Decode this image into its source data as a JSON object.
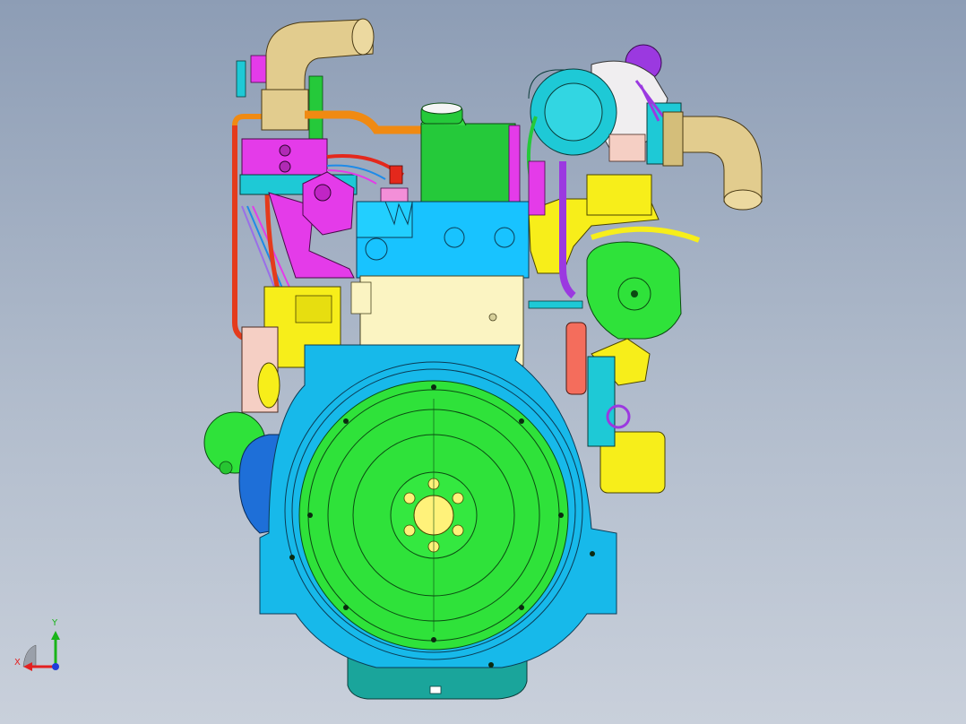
{
  "viewport": {
    "background_top": "#8d9db5",
    "background_bottom": "#c9d0db"
  },
  "model": {
    "description_icon": "engine-3d-model",
    "colors": {
      "flywheel": "#2fe23a",
      "housing": "#17b9ea",
      "block": "#fbf4c2",
      "head": "#18c3ff",
      "valve_cover": "#25c93a",
      "exhaust_pipe": "#e2cc8e",
      "manifold": "#e43be9",
      "turbo": "#1ec9d6",
      "yellow_parts": "#f7ee1a",
      "oil_pan": "#1aa59b",
      "oil_pipe": "#f08a12"
    }
  },
  "triad": {
    "x_label": "X",
    "y_label": "Y",
    "x_color": "#e32020",
    "y_color": "#19b419",
    "z_color": "#1f3cdb"
  }
}
